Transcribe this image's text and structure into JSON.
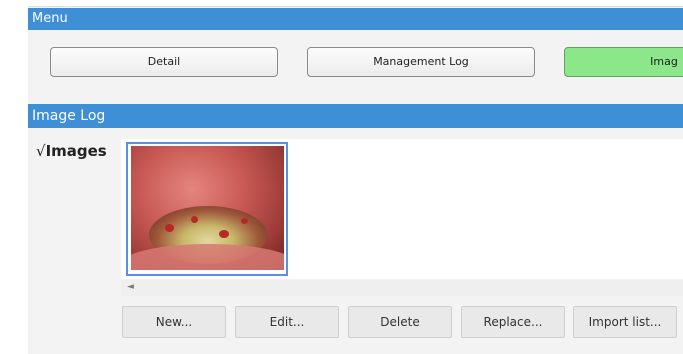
{
  "menu": {
    "title": "Menu",
    "buttons": [
      {
        "label": "Detail"
      },
      {
        "label": "Management Log"
      },
      {
        "label": "Imag"
      }
    ],
    "active_color": "#8ce68a"
  },
  "image_log": {
    "title": "Image Log",
    "category": {
      "check": "√",
      "label": "Images"
    },
    "thumbnails": [
      {
        "icon": "image-thumbnail"
      }
    ],
    "actions": [
      {
        "label": "New..."
      },
      {
        "label": "Edit..."
      },
      {
        "label": "Delete"
      },
      {
        "label": "Replace..."
      },
      {
        "label": "Import list..."
      }
    ]
  },
  "colors": {
    "header": "#3e8fd6",
    "selection": "#5b8fe0"
  }
}
